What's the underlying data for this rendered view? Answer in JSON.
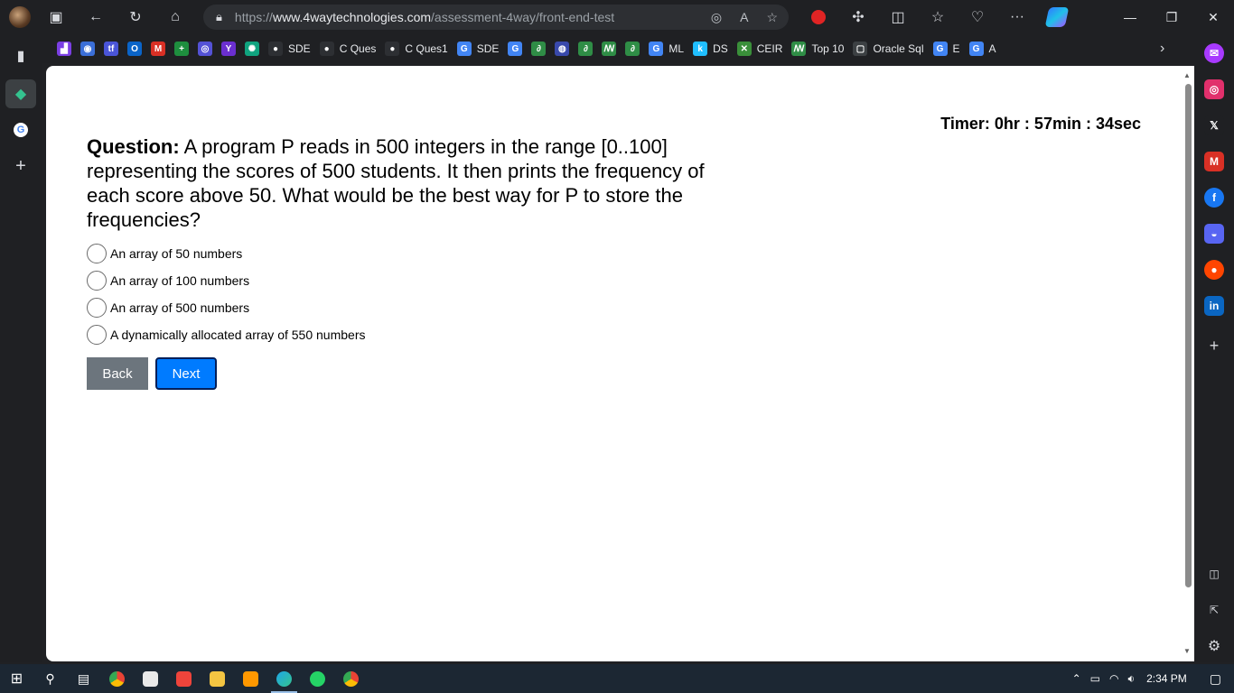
{
  "browser": {
    "url_prefix": "https://",
    "url_host": "www.4waytechnologies.com",
    "url_path": "/assessment-4way/front-end-test",
    "window_controls": [
      "—",
      "❐",
      "✕"
    ]
  },
  "favorites": [
    {
      "label": "",
      "icon": "twitch-icon",
      "color": "#7b3fe4",
      "glyph": "▟"
    },
    {
      "label": "",
      "icon": "compass-icon",
      "color": "#3b6fd8",
      "glyph": "◉"
    },
    {
      "label": "",
      "icon": "tf-icon",
      "color": "#4a55d8",
      "glyph": "tf"
    },
    {
      "label": "",
      "icon": "outlook-icon",
      "color": "#0a64c8",
      "glyph": "O"
    },
    {
      "label": "",
      "icon": "gmail-icon",
      "color": "#d93025",
      "glyph": "M"
    },
    {
      "label": "",
      "icon": "sheets-icon",
      "color": "#1e8e3e",
      "glyph": "+"
    },
    {
      "label": "",
      "icon": "codeium-icon",
      "color": "#5452d6",
      "glyph": "◎"
    },
    {
      "label": "",
      "icon": "yahoo-icon",
      "color": "#6b2fd0",
      "glyph": "Y"
    },
    {
      "label": "",
      "icon": "chatgpt-icon",
      "color": "#10a37f",
      "glyph": "✺"
    },
    {
      "label": "SDE",
      "icon": "github-icon",
      "color": "#2d2f33",
      "glyph": "●"
    },
    {
      "label": "C Ques",
      "icon": "github-icon",
      "color": "#2d2f33",
      "glyph": "●"
    },
    {
      "label": "C Ques1",
      "icon": "github-icon",
      "color": "#2d2f33",
      "glyph": "●"
    },
    {
      "label": "SDE",
      "icon": "google-icon",
      "color": "#4285f4",
      "glyph": "G"
    },
    {
      "label": "",
      "icon": "google-icon",
      "color": "#4285f4",
      "glyph": "G"
    },
    {
      "label": "",
      "icon": "geeks-icon",
      "color": "#2f8d46",
      "glyph": "∂"
    },
    {
      "label": "",
      "icon": "leetcode-icon",
      "color": "#3949ab",
      "glyph": "◍"
    },
    {
      "label": "",
      "icon": "geeks-icon",
      "color": "#2f8d46",
      "glyph": "∂"
    },
    {
      "label": "",
      "icon": "gfg-icon",
      "color": "#2f8d46",
      "glyph": "ꟿ"
    },
    {
      "label": "",
      "icon": "geeks-icon",
      "color": "#2f8d46",
      "glyph": "∂"
    },
    {
      "label": "ML",
      "icon": "google-icon",
      "color": "#4285f4",
      "glyph": "G"
    },
    {
      "label": "DS",
      "icon": "kaggle-icon",
      "color": "#20beff",
      "glyph": "k"
    },
    {
      "label": "CEIR",
      "icon": "ceir-icon",
      "color": "#3a8f3a",
      "glyph": "✕"
    },
    {
      "label": "Top 10",
      "icon": "gfg-icon",
      "color": "#2f8d46",
      "glyph": "ꟿ"
    },
    {
      "label": "Oracle Sql",
      "icon": "document-icon",
      "color": "#3c4043",
      "glyph": "▢"
    },
    {
      "label": "E",
      "icon": "google-icon",
      "color": "#4285f4",
      "glyph": "G"
    },
    {
      "label": "A",
      "icon": "google-icon",
      "color": "#4285f4",
      "glyph": "G"
    }
  ],
  "sidebar_apps": [
    {
      "icon": "messenger-icon",
      "color": "#a83aff",
      "glyph": "✉"
    },
    {
      "icon": "instagram-icon",
      "color": "#e1306c",
      "glyph": "◎"
    },
    {
      "icon": "x-icon",
      "color": "#1f2023",
      "glyph": "𝕏"
    },
    {
      "icon": "gmail-icon",
      "color": "#d93025",
      "glyph": "M"
    },
    {
      "icon": "facebook-icon",
      "color": "#1877f2",
      "glyph": "f"
    },
    {
      "icon": "discord-icon",
      "color": "#5865f2",
      "glyph": "◒"
    },
    {
      "icon": "reddit-icon",
      "color": "#ff4500",
      "glyph": "●"
    },
    {
      "icon": "linkedin-icon",
      "color": "#0a66c2",
      "glyph": "in"
    }
  ],
  "page": {
    "timer": "Timer: 0hr : 57min : 34sec",
    "question_label": "Question:",
    "question_text": " A program P reads in 500 integers in the range [0..100] representing the scores of 500 students. It then prints the frequency of each score above 50. What would be the best way for P to store the frequencies?",
    "options": [
      "An array of 50 numbers",
      "An array of 100 numbers",
      "An array of 500 numbers",
      "A dynamically allocated array of 550 numbers"
    ],
    "back_label": "Back",
    "next_label": "Next"
  },
  "taskbar": {
    "time": "2:34 PM"
  }
}
